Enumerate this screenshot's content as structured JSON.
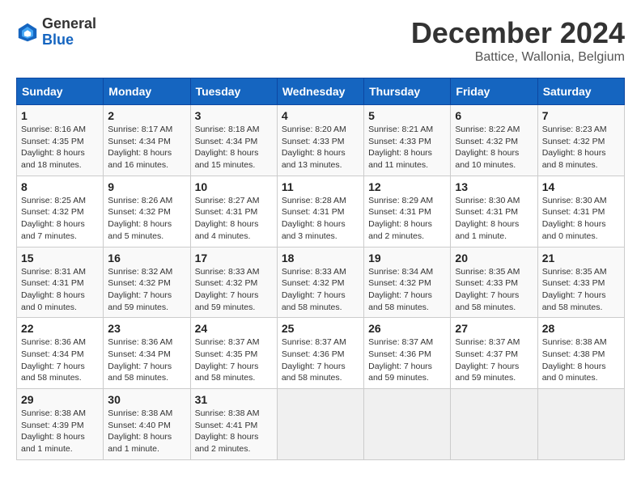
{
  "header": {
    "logo_line1": "General",
    "logo_line2": "Blue",
    "month": "December 2024",
    "location": "Battice, Wallonia, Belgium"
  },
  "days_of_week": [
    "Sunday",
    "Monday",
    "Tuesday",
    "Wednesday",
    "Thursday",
    "Friday",
    "Saturday"
  ],
  "weeks": [
    [
      {
        "day": "1",
        "info": "Sunrise: 8:16 AM\nSunset: 4:35 PM\nDaylight: 8 hours and 18 minutes."
      },
      {
        "day": "2",
        "info": "Sunrise: 8:17 AM\nSunset: 4:34 PM\nDaylight: 8 hours and 16 minutes."
      },
      {
        "day": "3",
        "info": "Sunrise: 8:18 AM\nSunset: 4:34 PM\nDaylight: 8 hours and 15 minutes."
      },
      {
        "day": "4",
        "info": "Sunrise: 8:20 AM\nSunset: 4:33 PM\nDaylight: 8 hours and 13 minutes."
      },
      {
        "day": "5",
        "info": "Sunrise: 8:21 AM\nSunset: 4:33 PM\nDaylight: 8 hours and 11 minutes."
      },
      {
        "day": "6",
        "info": "Sunrise: 8:22 AM\nSunset: 4:32 PM\nDaylight: 8 hours and 10 minutes."
      },
      {
        "day": "7",
        "info": "Sunrise: 8:23 AM\nSunset: 4:32 PM\nDaylight: 8 hours and 8 minutes."
      }
    ],
    [
      {
        "day": "8",
        "info": "Sunrise: 8:25 AM\nSunset: 4:32 PM\nDaylight: 8 hours and 7 minutes."
      },
      {
        "day": "9",
        "info": "Sunrise: 8:26 AM\nSunset: 4:32 PM\nDaylight: 8 hours and 5 minutes."
      },
      {
        "day": "10",
        "info": "Sunrise: 8:27 AM\nSunset: 4:31 PM\nDaylight: 8 hours and 4 minutes."
      },
      {
        "day": "11",
        "info": "Sunrise: 8:28 AM\nSunset: 4:31 PM\nDaylight: 8 hours and 3 minutes."
      },
      {
        "day": "12",
        "info": "Sunrise: 8:29 AM\nSunset: 4:31 PM\nDaylight: 8 hours and 2 minutes."
      },
      {
        "day": "13",
        "info": "Sunrise: 8:30 AM\nSunset: 4:31 PM\nDaylight: 8 hours and 1 minute."
      },
      {
        "day": "14",
        "info": "Sunrise: 8:30 AM\nSunset: 4:31 PM\nDaylight: 8 hours and 0 minutes."
      }
    ],
    [
      {
        "day": "15",
        "info": "Sunrise: 8:31 AM\nSunset: 4:31 PM\nDaylight: 8 hours and 0 minutes."
      },
      {
        "day": "16",
        "info": "Sunrise: 8:32 AM\nSunset: 4:32 PM\nDaylight: 7 hours and 59 minutes."
      },
      {
        "day": "17",
        "info": "Sunrise: 8:33 AM\nSunset: 4:32 PM\nDaylight: 7 hours and 59 minutes."
      },
      {
        "day": "18",
        "info": "Sunrise: 8:33 AM\nSunset: 4:32 PM\nDaylight: 7 hours and 58 minutes."
      },
      {
        "day": "19",
        "info": "Sunrise: 8:34 AM\nSunset: 4:32 PM\nDaylight: 7 hours and 58 minutes."
      },
      {
        "day": "20",
        "info": "Sunrise: 8:35 AM\nSunset: 4:33 PM\nDaylight: 7 hours and 58 minutes."
      },
      {
        "day": "21",
        "info": "Sunrise: 8:35 AM\nSunset: 4:33 PM\nDaylight: 7 hours and 58 minutes."
      }
    ],
    [
      {
        "day": "22",
        "info": "Sunrise: 8:36 AM\nSunset: 4:34 PM\nDaylight: 7 hours and 58 minutes."
      },
      {
        "day": "23",
        "info": "Sunrise: 8:36 AM\nSunset: 4:34 PM\nDaylight: 7 hours and 58 minutes."
      },
      {
        "day": "24",
        "info": "Sunrise: 8:37 AM\nSunset: 4:35 PM\nDaylight: 7 hours and 58 minutes."
      },
      {
        "day": "25",
        "info": "Sunrise: 8:37 AM\nSunset: 4:36 PM\nDaylight: 7 hours and 58 minutes."
      },
      {
        "day": "26",
        "info": "Sunrise: 8:37 AM\nSunset: 4:36 PM\nDaylight: 7 hours and 59 minutes."
      },
      {
        "day": "27",
        "info": "Sunrise: 8:37 AM\nSunset: 4:37 PM\nDaylight: 7 hours and 59 minutes."
      },
      {
        "day": "28",
        "info": "Sunrise: 8:38 AM\nSunset: 4:38 PM\nDaylight: 8 hours and 0 minutes."
      }
    ],
    [
      {
        "day": "29",
        "info": "Sunrise: 8:38 AM\nSunset: 4:39 PM\nDaylight: 8 hours and 1 minute."
      },
      {
        "day": "30",
        "info": "Sunrise: 8:38 AM\nSunset: 4:40 PM\nDaylight: 8 hours and 1 minute."
      },
      {
        "day": "31",
        "info": "Sunrise: 8:38 AM\nSunset: 4:41 PM\nDaylight: 8 hours and 2 minutes."
      },
      null,
      null,
      null,
      null
    ]
  ]
}
